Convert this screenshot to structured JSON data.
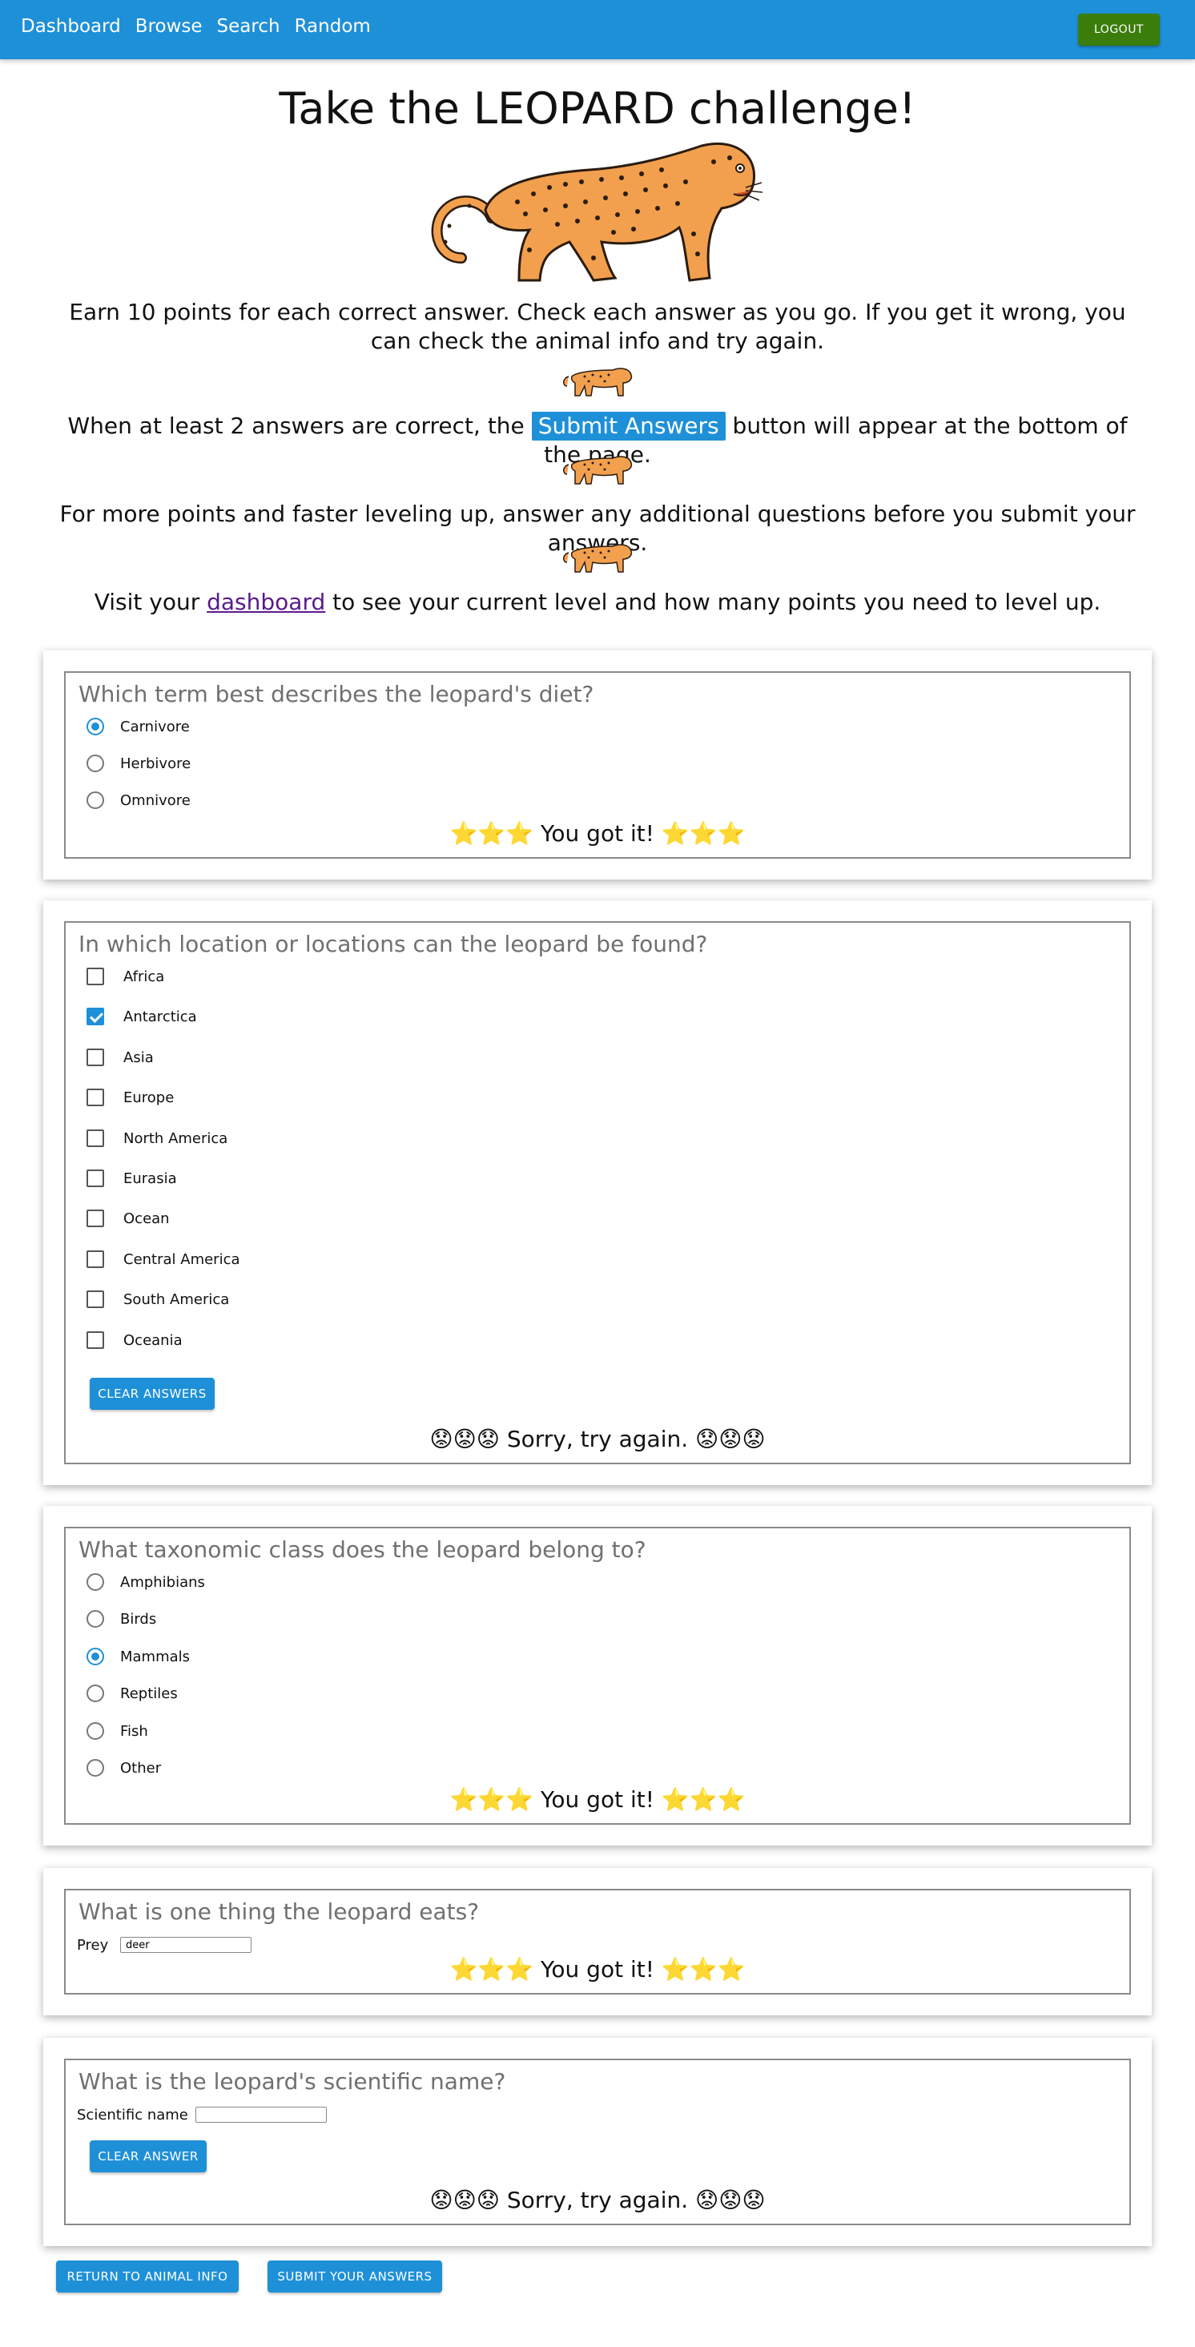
{
  "nav": {
    "links": [
      "Dashboard",
      "Browse",
      "Search",
      "Random"
    ],
    "logout": "LOGOUT"
  },
  "title": "Take the LEOPARD challenge!",
  "intro": {
    "p1": "Earn 10 points for each correct answer. Check each answer as you go. If you get it wrong, you can check the animal info and try again.",
    "p2_before": "When at least 2 answers are correct, the",
    "p2_button": "Submit Answers",
    "p2_after": "button will appear at the bottom of the page.",
    "p3": "For more points and faster leveling up, answer any additional questions before you submit your answers.",
    "p4_before": "Visit your",
    "p4_link": "dashboard",
    "p4_after": "to see your current level and how many points you need to level up."
  },
  "questions": {
    "q1": {
      "question": "Which term best describes the leopard's diet?",
      "options": [
        "Carnivore",
        "Herbivore",
        "Omnivore"
      ],
      "selected": "Carnivore",
      "feedback": "⭐⭐⭐ You got it! ⭐⭐⭐"
    },
    "q2": {
      "question": "In which location or locations can the leopard be found?",
      "options": [
        "Africa",
        "Antarctica",
        "Asia",
        "Europe",
        "North America",
        "Eurasia",
        "Ocean",
        "Central America",
        "South America",
        "Oceania"
      ],
      "checked": [
        "Antarctica"
      ],
      "clear_label": "CLEAR ANSWERS",
      "feedback": "😟😟😟 Sorry, try again. 😟😟😟"
    },
    "q3": {
      "question": "What taxonomic class does the leopard belong to?",
      "options": [
        "Amphibians",
        "Birds",
        "Mammals",
        "Reptiles",
        "Fish",
        "Other"
      ],
      "selected": "Mammals",
      "feedback": "⭐⭐⭐ You got it! ⭐⭐⭐"
    },
    "q4": {
      "question": "What is one thing the leopard eats?",
      "label": "Prey",
      "value": "deer",
      "feedback": "⭐⭐⭐ You got it! ⭐⭐⭐"
    },
    "q5": {
      "question": "What is the leopard's scientific name?",
      "label": "Scientific name",
      "value": "",
      "clear_label": "CLEAR ANSWER",
      "feedback": "😟😟😟 Sorry, try again. 😟😟😟"
    }
  },
  "bottom": {
    "return_label": "RETURN TO ANIMAL INFO",
    "submit_label": "SUBMIT YOUR ANSWERS"
  },
  "colors": {
    "primary": "#1e90d8",
    "logout": "#3a7d0a",
    "leopard_body": "#f2a04e",
    "spots": "#2b1c10"
  }
}
